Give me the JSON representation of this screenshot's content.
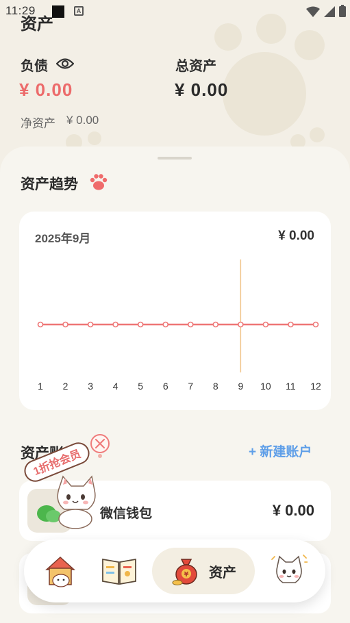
{
  "status_bar": {
    "time": "11:29"
  },
  "header": {
    "title": "资产",
    "liabilities_label": "负债",
    "liabilities_value": "¥ 0.00",
    "total_assets_label": "总资产",
    "total_assets_value": "¥ 0.00",
    "net_assets_label": "净资产",
    "net_assets_value": "¥ 0.00"
  },
  "trend": {
    "title": "资产趋势",
    "month": "2025年9月",
    "amount": "¥ 0.00"
  },
  "chart_data": {
    "type": "line",
    "x": [
      1,
      2,
      3,
      4,
      5,
      6,
      7,
      8,
      9,
      10,
      11,
      12
    ],
    "series": [
      {
        "values": [
          0,
          0,
          0,
          0,
          0,
          0,
          0,
          0,
          0,
          0,
          0,
          0
        ],
        "color": "#ee7676"
      }
    ],
    "highlight_x": 9,
    "highlight_color": "#f0c58a",
    "xlabel": "",
    "ylabel": "",
    "grid": false
  },
  "accounts": {
    "title": "资产账户",
    "new_account_label": "+ 新建账户",
    "items": [
      {
        "name": "微信钱包",
        "value": "¥ 0.00"
      }
    ]
  },
  "promo": {
    "text": "1折抢会员"
  },
  "nav": {
    "items": [
      {
        "icon": "house-cat-icon"
      },
      {
        "icon": "ledger-book-icon"
      },
      {
        "icon": "money-bag-icon",
        "label": "资产",
        "active": true
      },
      {
        "icon": "cat-face-icon"
      }
    ]
  },
  "colors": {
    "liabilities": "#ec6b6b",
    "accent_blue": "#5e9ee8",
    "background": "#f3efe6"
  }
}
